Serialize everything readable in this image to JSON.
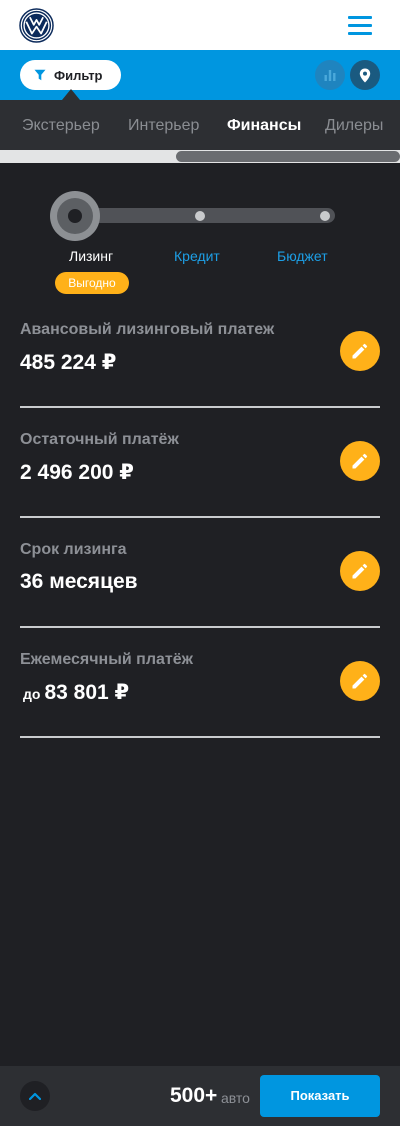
{
  "header": {
    "logo": "Volkswagen",
    "menu_icon": "hamburger-menu-icon"
  },
  "filterbar": {
    "filter_label": "Фильтр",
    "filter_icon": "funnel-icon",
    "stats_icon": "bar-chart-icon",
    "map_icon": "map-pin-icon"
  },
  "tabs": [
    {
      "label": "Экстерьер",
      "active": false
    },
    {
      "label": "Интерьер",
      "active": false
    },
    {
      "label": "Финансы",
      "active": true
    },
    {
      "label": "Дилеры",
      "active": false
    }
  ],
  "finance_mode": {
    "options": [
      {
        "label": "Лизинг",
        "selected": true
      },
      {
        "label": "Кредит",
        "selected": false
      },
      {
        "label": "Бюджет",
        "selected": false
      }
    ],
    "badge": "Выгодно"
  },
  "rows": [
    {
      "label": "Авансовый лизинговый платеж",
      "prefix": "",
      "value": "485 224 ₽",
      "edit_icon": "pencil-icon"
    },
    {
      "label": "Остаточный платёж",
      "prefix": "",
      "value": "2 496 200 ₽",
      "edit_icon": "pencil-icon"
    },
    {
      "label": "Срок лизинга",
      "prefix": "",
      "value": "36 месяцев",
      "edit_icon": "pencil-icon"
    },
    {
      "label": "Ежемесячный платёж",
      "prefix": "до",
      "value": "83 801 ₽",
      "edit_icon": "pencil-icon"
    }
  ],
  "bottombar": {
    "count": "500+",
    "count_unit": "авто",
    "show_label": "Показать",
    "up_icon": "chevron-up-icon"
  },
  "colors": {
    "accent_blue": "#0096e0",
    "accent_yellow": "#ffb119",
    "background": "#1f2024",
    "panel": "#2d2f33"
  }
}
